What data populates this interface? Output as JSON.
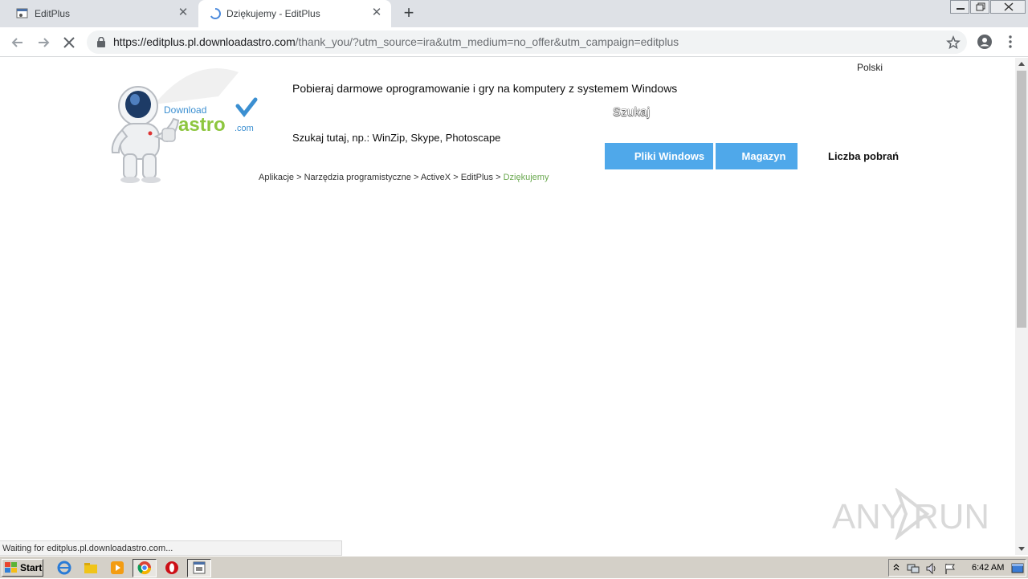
{
  "browser": {
    "tabs": [
      {
        "title": "EditPlus",
        "active": false,
        "favicon": "editplus-favicon"
      },
      {
        "title": "Dziękujemy - EditPlus",
        "active": true,
        "favicon": "loading-spinner-icon"
      }
    ],
    "url_host": "https://editplus.pl.downloadastro.com",
    "url_rest": "/thank_you/?utm_source=ira&utm_medium=no_offer&utm_campaign=editplus",
    "status_text": "Waiting for editplus.pl.downloadastro.com..."
  },
  "page": {
    "language": "Polski",
    "logo": {
      "word1": "Download",
      "word2": "astro",
      "word3": ".com"
    },
    "tagline": "Pobieraj darmowe oprogramowanie i gry na komputery z systemem Windows",
    "search_label": "Szukaj",
    "search_hint": "Szukaj tutaj, np.: WinZip, Skype, Photoscape",
    "nav": {
      "windows_files": "Pliki Windows",
      "magazine": "Magazyn",
      "downloads_count": "Liczba pobrań"
    },
    "breadcrumb": {
      "items": [
        "Aplikacje",
        "Narzędzia programistyczne",
        "ActiveX",
        "EditPlus"
      ],
      "separator": ">",
      "current": "Dziękujemy"
    },
    "watermark": "ANY RUN"
  },
  "taskbar": {
    "start_label": "Start",
    "clock": "6:42 AM"
  },
  "colors": {
    "accent_blue": "#4fa8ea",
    "breadcrumb_current": "#6aa84f",
    "logo_green": "#8dc63f",
    "logo_blue": "#3b8fd1"
  }
}
